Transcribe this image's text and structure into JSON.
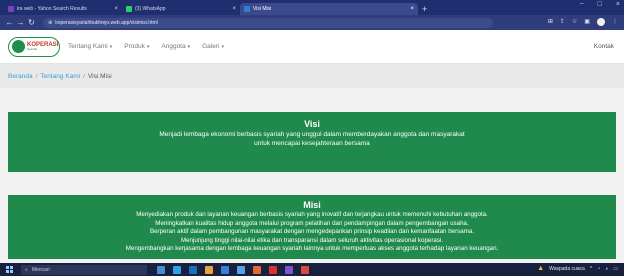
{
  "browser": {
    "tabs": [
      {
        "title": "ira web - Yahoo Search Results",
        "favicon_color": "#7b3fc4"
      },
      {
        "title": "(3) WhatsApp",
        "favicon_color": "#25d366"
      },
      {
        "title": "Visi Misi",
        "favicon_color": "#2f7fd0"
      }
    ],
    "new_tab_label": "+",
    "url": "koperasisyariahbukitrejo.web.app/visimisi.html"
  },
  "site": {
    "logo_main": "KOPERASI",
    "logo_sub": "Syariah",
    "menu": [
      {
        "label": "Tentang Kami",
        "has_dropdown": true
      },
      {
        "label": "Produk",
        "has_dropdown": true
      },
      {
        "label": "Anggota",
        "has_dropdown": true
      },
      {
        "label": "Galeri",
        "has_dropdown": true
      }
    ],
    "contact_label": "Kontak",
    "colors": {
      "primary_green": "#208a4d",
      "link_blue": "#3aa0d8",
      "logo_red": "#c0392b"
    }
  },
  "breadcrumb": {
    "items": [
      "Beranda",
      "Tentang Kami"
    ],
    "current": "Visi Misi",
    "separator": "/"
  },
  "visi": {
    "heading": "Visi",
    "text": "Menjadi lembaga ekonomi berbasis syariah yang unggul dalam memberdayakan anggota dan masyarakat untuk mencapai kesejahteraan bersama"
  },
  "misi": {
    "heading": "Misi",
    "items": [
      "Menyediakan produk dan layanan keuangan berbasis syariah yang inovatif dan terjangkau untuk memenuhi kebutuhan anggota.",
      "Meningkatkan kualitas hidup anggota melalui program pelatihan dan pendampingan dalam pengembangan usaha.",
      "Berperan aktif dalam pembangunan masyarakat dengan mengedepankan prinsip keadilan dan kemanfaatan bersama.",
      "Menjunjung tinggi nilai-nilai etika dan transparansi dalam seluruh aktivitas operasional koperasi.",
      "Mengembangkan kerjasama dengan lembaga keuangan syariah lainnya untuk memperluas akses anggota terhadap layanan keuangan."
    ]
  },
  "taskbar": {
    "search_placeholder": "Mencari",
    "weather_text": "Waspada cuaca",
    "app_colors": [
      "#4a8ad6",
      "#2fa0e8",
      "#1f6fb8",
      "#e8a53a",
      "#3b7dd8",
      "#5aa2e6",
      "#e06a2f",
      "#d9342b",
      "#7a56c9",
      "#d74a3c"
    ]
  }
}
